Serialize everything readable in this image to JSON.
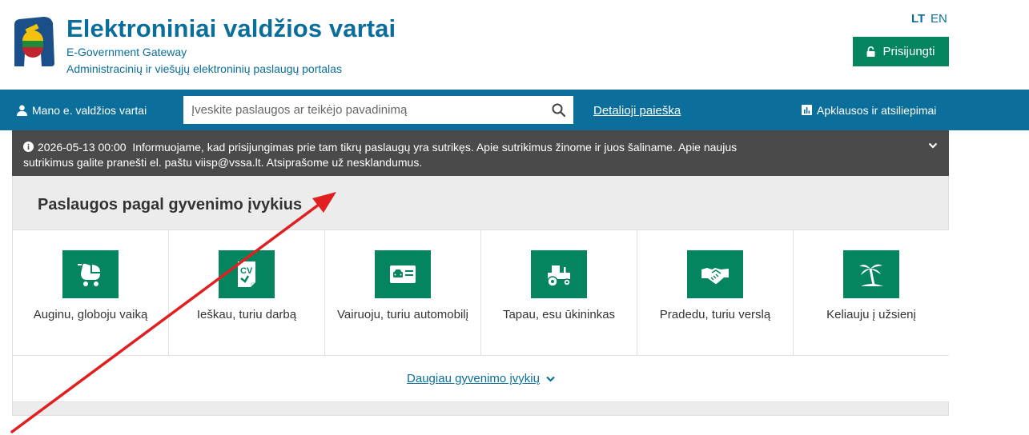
{
  "header": {
    "title": "Elektroniniai valdžios vartai",
    "subtitle_en": "E-Government Gateway",
    "subtitle_lt": "Administracinių ir viešųjų elektroninių paslaugų portalas",
    "lang_lt": "LT",
    "lang_en": "EN",
    "login_label": "Prisijungti"
  },
  "navbar": {
    "user_label": "Mano e. valdžios vartai",
    "search_placeholder": "Įveskite paslaugos ar teikėjo pavadinimą",
    "detail_search_label": "Detalioji paieška",
    "survey_label": "Apklausos ir atsiliepimai"
  },
  "notice": {
    "datetime": "2026-05-13 00:00",
    "text": "Informuojame, kad prisijungimas prie tam tikrų paslaugų yra sutrikęs. Apie sutrikimus žinome ir juos šaliname. Apie naujus sutrikimus galite pranešti el. paštu viisp@vssa.lt. Atsiprašome už nesklandumus."
  },
  "life_events": {
    "title": "Paslaugos pagal gyvenimo įvykius",
    "items": [
      {
        "label": "Auginu, globoju vaiką",
        "icon": "stroller-icon"
      },
      {
        "label": "Ieškau, turiu darbą",
        "icon": "cv-icon"
      },
      {
        "label": "Vairuoju, turiu automobilį",
        "icon": "driver-license-icon"
      },
      {
        "label": "Tapau, esu ūkininkas",
        "icon": "tractor-icon"
      },
      {
        "label": "Pradedu, turiu verslą",
        "icon": "handshake-icon"
      },
      {
        "label": "Keliauju į užsienį",
        "icon": "palm-tree-icon"
      }
    ],
    "more_label": "Daugiau gyvenimo įvykių"
  },
  "colors": {
    "brand_blue": "#0b6e9b",
    "brand_green": "#04845f",
    "notice_bg": "#4a4a4a",
    "annotation_red": "#e02020"
  }
}
